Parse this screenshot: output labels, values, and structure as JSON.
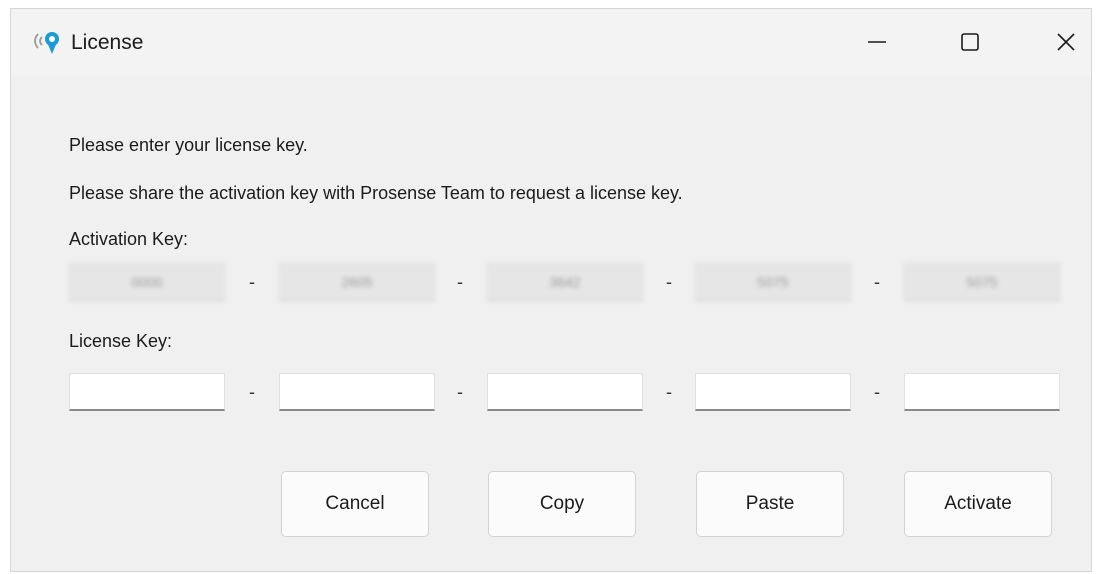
{
  "window": {
    "title": "License",
    "icon": "signal-pin-icon",
    "controls": {
      "minimize": "minimize-icon",
      "maximize": "maximize-icon",
      "close": "close-icon"
    }
  },
  "instructions": {
    "line1": "Please enter your license key.",
    "line2": "Please share the activation key with Prosense Team to request a  license key."
  },
  "activation": {
    "label": "Activation Key:",
    "fields": [
      "0000",
      "2605",
      "3642",
      "5075",
      "5075"
    ]
  },
  "license": {
    "label": "License Key:",
    "fields": [
      "",
      "",
      "",
      "",
      ""
    ]
  },
  "separator": "-",
  "buttons": {
    "cancel": "Cancel",
    "copy": "Copy",
    "paste": "Paste",
    "activate": "Activate"
  },
  "colors": {
    "window_bg": "#f0f0f0",
    "icon_accent": "#1a9ad6",
    "icon_waves": "#9a9a9a"
  }
}
